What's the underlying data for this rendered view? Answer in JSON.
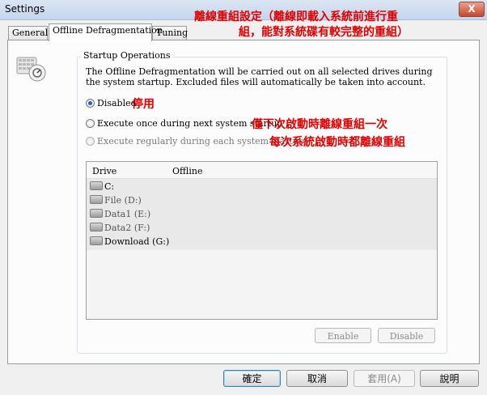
{
  "window": {
    "title": "Settings",
    "close_glyph": "X"
  },
  "annotation": {
    "header_line1": "離線重組設定（離線即載入系統前進行重",
    "header_line2": "組，能對系統碟有較完整的重組）",
    "disabled": "停用",
    "once": "僅下次啟動時離線重組一次",
    "regularly": "每次系統啟動時都離線重組"
  },
  "tabs": [
    {
      "label": "General",
      "active": false
    },
    {
      "label": "Offline Defragmentation",
      "active": true
    },
    {
      "label": "Tuning",
      "active": false
    }
  ],
  "startup": {
    "group_label": "Startup Operations",
    "description": "The Offline Defragmentation will be carried out on all selected drives during the system startup. Excluded files will automatically be taken into account.",
    "options": [
      {
        "label": "Disabled",
        "selected": true,
        "enabled": true
      },
      {
        "label": "Execute once during next system startup",
        "selected": false,
        "enabled": true
      },
      {
        "label": "Execute regularly during each system startup",
        "selected": false,
        "enabled": false
      }
    ]
  },
  "drives": {
    "columns": [
      "Drive",
      "Offline"
    ],
    "rows": [
      {
        "name": "C:"
      },
      {
        "name": "File (D:)"
      },
      {
        "name": "Data1 (E:)"
      },
      {
        "name": "Data2 (F:)"
      },
      {
        "name": "Download (G:)"
      }
    ]
  },
  "list_buttons": {
    "enable": "Enable",
    "disable": "Disable"
  },
  "footer": {
    "ok": "確定",
    "cancel": "取消",
    "apply": "套用(A)",
    "help": "說明"
  },
  "icons": {
    "app": "defrag-drives-icon",
    "drive": "hard-drive-icon"
  }
}
